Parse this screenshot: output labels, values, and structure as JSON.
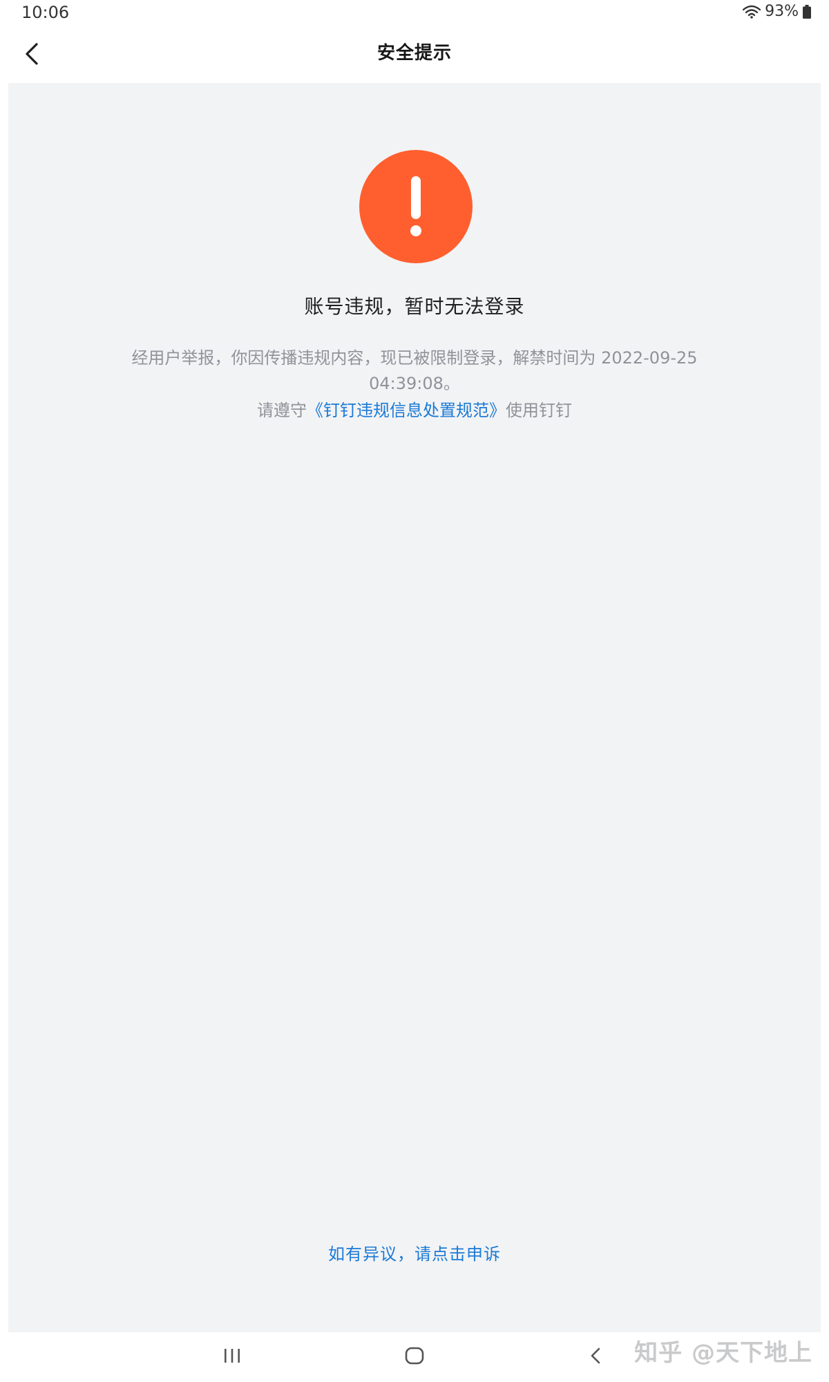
{
  "status_bar": {
    "time": "10:06",
    "battery": "93%",
    "icons": [
      "wifi-icon",
      "battery-icon"
    ]
  },
  "header": {
    "title": "安全提示",
    "back_icon": "chevron-left-icon"
  },
  "main": {
    "alert_icon": "exclamation-circle-icon",
    "alert_color": "#ff5f2e",
    "headline": "账号违规，暂时无法登录",
    "description": "经用户举报，你因传播违规内容，现已被限制登录，解禁时间为 2022-09-25 04:39:08。",
    "policy_prefix": "请遵守",
    "policy_link": "《钉钉违规信息处置规范》",
    "policy_suffix": "使用钉钉",
    "appeal_link": "如有异议，请点击申诉",
    "link_color": "#1a7ad6"
  },
  "nav_bar": {
    "recents_icon": "recents-icon",
    "home_icon": "home-icon",
    "back_icon": "back-arrow-icon"
  },
  "watermark": "知乎 @天下地上"
}
